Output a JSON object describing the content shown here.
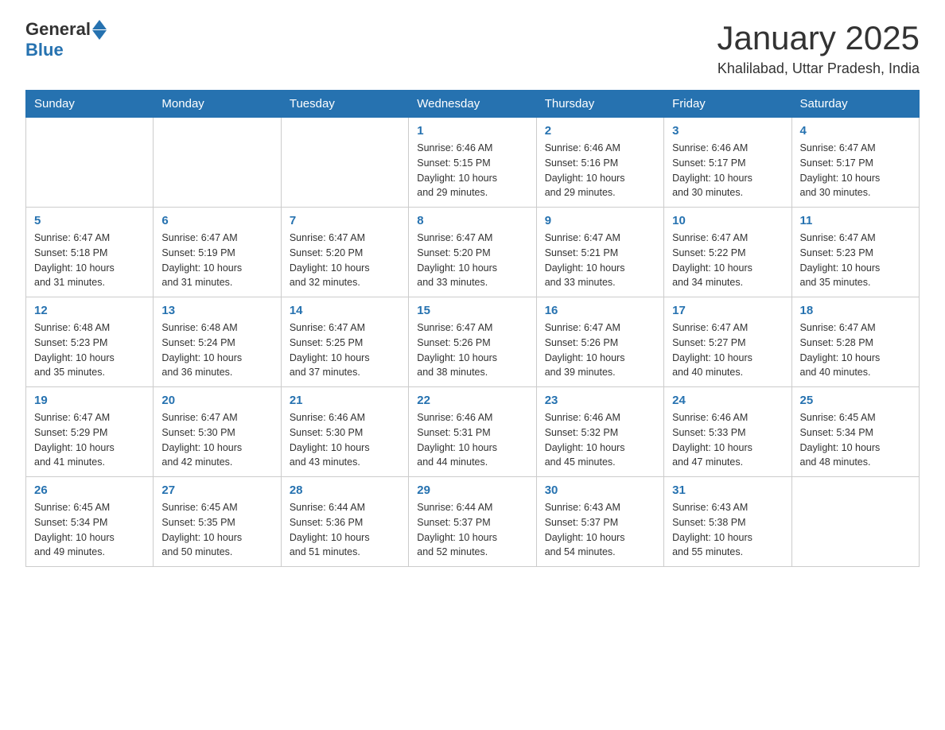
{
  "header": {
    "logo_general": "General",
    "logo_blue": "Blue",
    "month_title": "January 2025",
    "location": "Khalilabad, Uttar Pradesh, India"
  },
  "days_of_week": [
    "Sunday",
    "Monday",
    "Tuesday",
    "Wednesday",
    "Thursday",
    "Friday",
    "Saturday"
  ],
  "weeks": [
    [
      {
        "day": "",
        "info": ""
      },
      {
        "day": "",
        "info": ""
      },
      {
        "day": "",
        "info": ""
      },
      {
        "day": "1",
        "info": "Sunrise: 6:46 AM\nSunset: 5:15 PM\nDaylight: 10 hours\nand 29 minutes."
      },
      {
        "day": "2",
        "info": "Sunrise: 6:46 AM\nSunset: 5:16 PM\nDaylight: 10 hours\nand 29 minutes."
      },
      {
        "day": "3",
        "info": "Sunrise: 6:46 AM\nSunset: 5:17 PM\nDaylight: 10 hours\nand 30 minutes."
      },
      {
        "day": "4",
        "info": "Sunrise: 6:47 AM\nSunset: 5:17 PM\nDaylight: 10 hours\nand 30 minutes."
      }
    ],
    [
      {
        "day": "5",
        "info": "Sunrise: 6:47 AM\nSunset: 5:18 PM\nDaylight: 10 hours\nand 31 minutes."
      },
      {
        "day": "6",
        "info": "Sunrise: 6:47 AM\nSunset: 5:19 PM\nDaylight: 10 hours\nand 31 minutes."
      },
      {
        "day": "7",
        "info": "Sunrise: 6:47 AM\nSunset: 5:20 PM\nDaylight: 10 hours\nand 32 minutes."
      },
      {
        "day": "8",
        "info": "Sunrise: 6:47 AM\nSunset: 5:20 PM\nDaylight: 10 hours\nand 33 minutes."
      },
      {
        "day": "9",
        "info": "Sunrise: 6:47 AM\nSunset: 5:21 PM\nDaylight: 10 hours\nand 33 minutes."
      },
      {
        "day": "10",
        "info": "Sunrise: 6:47 AM\nSunset: 5:22 PM\nDaylight: 10 hours\nand 34 minutes."
      },
      {
        "day": "11",
        "info": "Sunrise: 6:47 AM\nSunset: 5:23 PM\nDaylight: 10 hours\nand 35 minutes."
      }
    ],
    [
      {
        "day": "12",
        "info": "Sunrise: 6:48 AM\nSunset: 5:23 PM\nDaylight: 10 hours\nand 35 minutes."
      },
      {
        "day": "13",
        "info": "Sunrise: 6:48 AM\nSunset: 5:24 PM\nDaylight: 10 hours\nand 36 minutes."
      },
      {
        "day": "14",
        "info": "Sunrise: 6:47 AM\nSunset: 5:25 PM\nDaylight: 10 hours\nand 37 minutes."
      },
      {
        "day": "15",
        "info": "Sunrise: 6:47 AM\nSunset: 5:26 PM\nDaylight: 10 hours\nand 38 minutes."
      },
      {
        "day": "16",
        "info": "Sunrise: 6:47 AM\nSunset: 5:26 PM\nDaylight: 10 hours\nand 39 minutes."
      },
      {
        "day": "17",
        "info": "Sunrise: 6:47 AM\nSunset: 5:27 PM\nDaylight: 10 hours\nand 40 minutes."
      },
      {
        "day": "18",
        "info": "Sunrise: 6:47 AM\nSunset: 5:28 PM\nDaylight: 10 hours\nand 40 minutes."
      }
    ],
    [
      {
        "day": "19",
        "info": "Sunrise: 6:47 AM\nSunset: 5:29 PM\nDaylight: 10 hours\nand 41 minutes."
      },
      {
        "day": "20",
        "info": "Sunrise: 6:47 AM\nSunset: 5:30 PM\nDaylight: 10 hours\nand 42 minutes."
      },
      {
        "day": "21",
        "info": "Sunrise: 6:46 AM\nSunset: 5:30 PM\nDaylight: 10 hours\nand 43 minutes."
      },
      {
        "day": "22",
        "info": "Sunrise: 6:46 AM\nSunset: 5:31 PM\nDaylight: 10 hours\nand 44 minutes."
      },
      {
        "day": "23",
        "info": "Sunrise: 6:46 AM\nSunset: 5:32 PM\nDaylight: 10 hours\nand 45 minutes."
      },
      {
        "day": "24",
        "info": "Sunrise: 6:46 AM\nSunset: 5:33 PM\nDaylight: 10 hours\nand 47 minutes."
      },
      {
        "day": "25",
        "info": "Sunrise: 6:45 AM\nSunset: 5:34 PM\nDaylight: 10 hours\nand 48 minutes."
      }
    ],
    [
      {
        "day": "26",
        "info": "Sunrise: 6:45 AM\nSunset: 5:34 PM\nDaylight: 10 hours\nand 49 minutes."
      },
      {
        "day": "27",
        "info": "Sunrise: 6:45 AM\nSunset: 5:35 PM\nDaylight: 10 hours\nand 50 minutes."
      },
      {
        "day": "28",
        "info": "Sunrise: 6:44 AM\nSunset: 5:36 PM\nDaylight: 10 hours\nand 51 minutes."
      },
      {
        "day": "29",
        "info": "Sunrise: 6:44 AM\nSunset: 5:37 PM\nDaylight: 10 hours\nand 52 minutes."
      },
      {
        "day": "30",
        "info": "Sunrise: 6:43 AM\nSunset: 5:37 PM\nDaylight: 10 hours\nand 54 minutes."
      },
      {
        "day": "31",
        "info": "Sunrise: 6:43 AM\nSunset: 5:38 PM\nDaylight: 10 hours\nand 55 minutes."
      },
      {
        "day": "",
        "info": ""
      }
    ]
  ]
}
